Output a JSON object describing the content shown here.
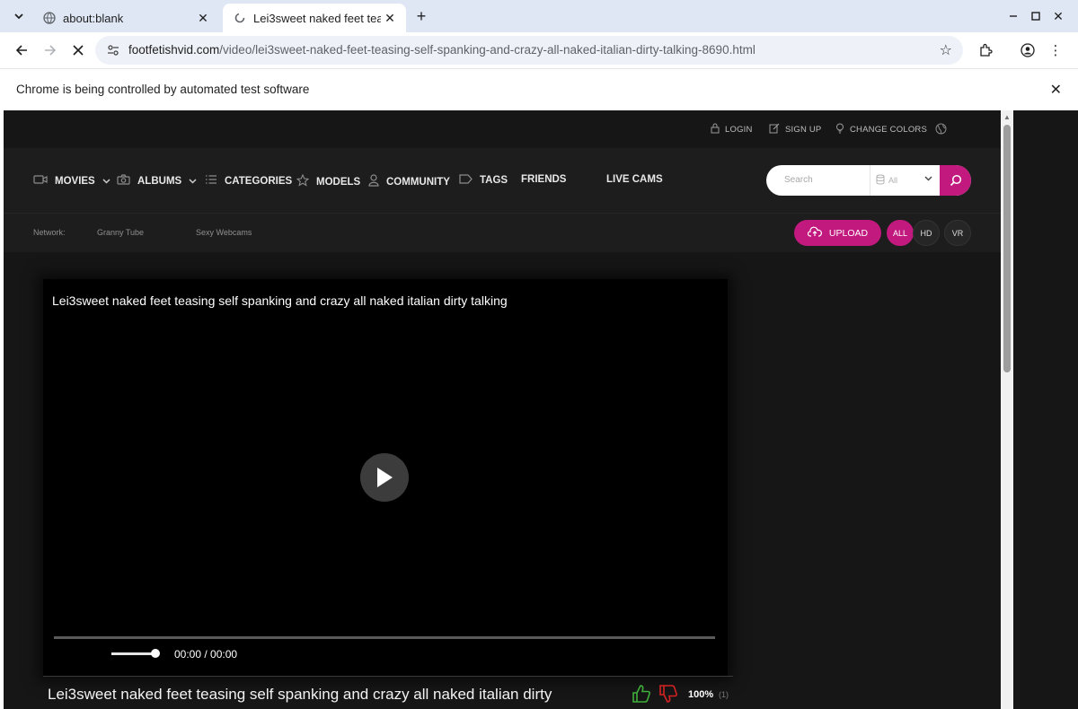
{
  "browser": {
    "tabs": [
      {
        "title": "about:blank",
        "active": false,
        "favicon": "globe-icon"
      },
      {
        "title": "Lei3sweet naked feet tea",
        "active": true,
        "favicon": "loading-icon"
      }
    ],
    "url_domain": "footfetishvid.com",
    "url_path": "/video/lei3sweet-naked-feet-teasing-self-spanking-and-crazy-all-naked-italian-dirty-talking-8690.html",
    "infobar_message": "Chrome is being controlled by automated test software"
  },
  "site": {
    "accent_color": "#c2197f",
    "top_links": {
      "login": "LOGIN",
      "signup": "SIGN UP",
      "change_colors": "CHANGE COLORS"
    },
    "menu": {
      "movies": "MOVIES",
      "albums": "ALBUMS",
      "categories": "CATEGORIES",
      "models": "MODELS",
      "community": "COMMUNITY",
      "tags": "TAGS",
      "friends": "FRIENDS",
      "live_cams": "LIVE CAMS"
    },
    "search": {
      "placeholder": "Search",
      "filter_value": "All"
    },
    "network": {
      "label": "Network:",
      "links": [
        "Granny Tube",
        "Sexy Webcams"
      ]
    },
    "upload_label": "UPLOAD",
    "quality_filters": [
      "ALL",
      "HD",
      "VR"
    ],
    "active_quality": "ALL"
  },
  "video": {
    "title": "Lei3sweet naked feet teasing self spanking and crazy all naked italian dirty talking",
    "title_truncated": "Lei3sweet naked feet teasing self spanking and crazy all naked italian dirty",
    "time_display": "00:00 / 00:00",
    "progress_fraction": 0,
    "volume_fraction": 1.0,
    "rating_percent": "100%",
    "rating_count": "(1)"
  }
}
